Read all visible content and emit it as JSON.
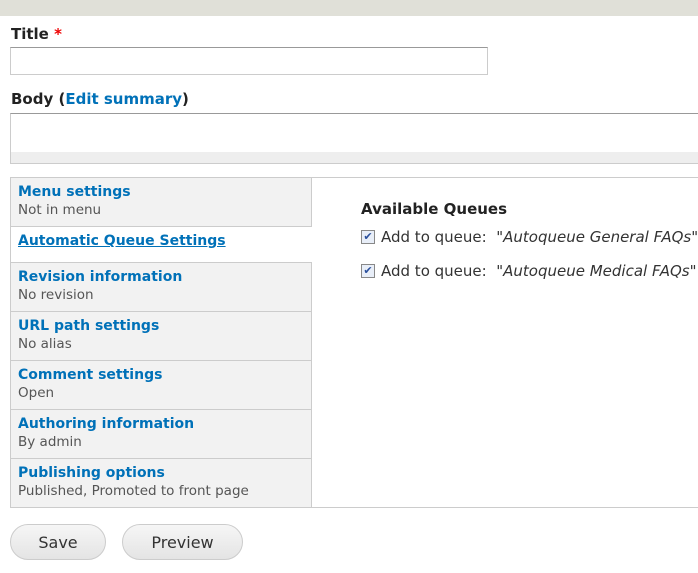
{
  "form": {
    "title_label": "Title",
    "required_mark": "*",
    "title_value": "",
    "body_label": "Body",
    "body_paren_open": " (",
    "edit_summary": "Edit summary",
    "body_paren_close": ")"
  },
  "tabs": [
    {
      "title": "Menu settings",
      "summary": "Not in menu"
    },
    {
      "title": "Automatic Queue Settings",
      "summary": "",
      "selected": true
    },
    {
      "title": "Revision information",
      "summary": "No revision"
    },
    {
      "title": "URL path settings",
      "summary": "No alias"
    },
    {
      "title": "Comment settings",
      "summary": "Open"
    },
    {
      "title": "Authoring information",
      "summary": "By admin"
    },
    {
      "title": "Publishing options",
      "summary": "Published, Promoted to front page"
    }
  ],
  "pane": {
    "heading": "Available Queues",
    "options": [
      {
        "prefix": "Add to queue:  \"",
        "name": "Autoqueue General FAQs",
        "suffix": "\"",
        "checked": true
      },
      {
        "prefix": "Add to queue:  \"",
        "name": "Autoqueue Medical FAQs",
        "suffix": "\"",
        "checked": true
      }
    ]
  },
  "actions": {
    "save": "Save",
    "preview": "Preview"
  }
}
